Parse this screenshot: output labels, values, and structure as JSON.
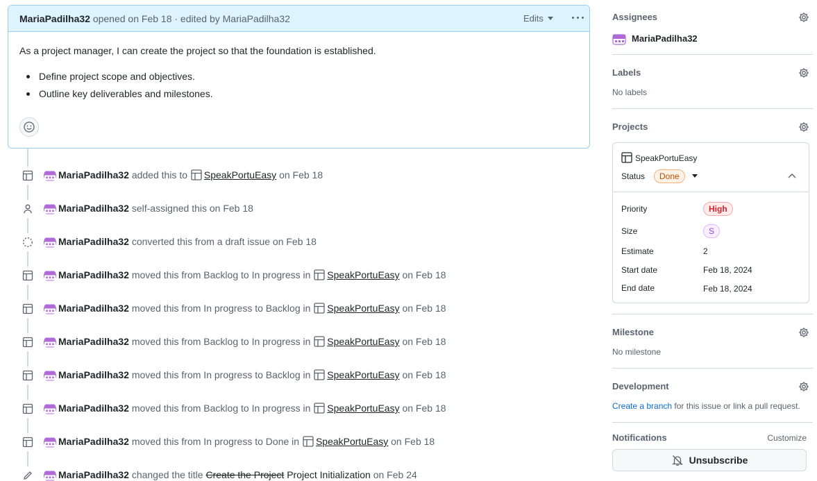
{
  "comment": {
    "author": "MariaPadilha32",
    "opened_text": "opened on Feb 18 · edited by MariaPadilha32",
    "edits_label": "Edits",
    "body_text": "As a project manager, I can create the project so that the foundation is established.",
    "bullets": [
      "Define project scope and objectives.",
      "Outline key deliverables and milestones."
    ]
  },
  "timeline": [
    {
      "icon": "table-icon",
      "actor": "MariaPadilha32",
      "pre": "added this to",
      "project": "SpeakPortuEasy",
      "post": "on Feb 18"
    },
    {
      "icon": "person-icon",
      "actor": "MariaPadilha32",
      "pre": "self-assigned this on Feb 18"
    },
    {
      "icon": "draft-issue-icon",
      "actor": "MariaPadilha32",
      "pre": "converted this from a draft issue on Feb 18"
    },
    {
      "icon": "table-icon",
      "actor": "MariaPadilha32",
      "pre": "moved this from Backlog to In progress in",
      "project": "SpeakPortuEasy",
      "post": "on Feb 18"
    },
    {
      "icon": "table-icon",
      "actor": "MariaPadilha32",
      "pre": "moved this from In progress to Backlog in",
      "project": "SpeakPortuEasy",
      "post": "on Feb 18"
    },
    {
      "icon": "table-icon",
      "actor": "MariaPadilha32",
      "pre": "moved this from Backlog to In progress in",
      "project": "SpeakPortuEasy",
      "post": "on Feb 18"
    },
    {
      "icon": "table-icon",
      "actor": "MariaPadilha32",
      "pre": "moved this from In progress to Backlog in",
      "project": "SpeakPortuEasy",
      "post": "on Feb 18"
    },
    {
      "icon": "table-icon",
      "actor": "MariaPadilha32",
      "pre": "moved this from Backlog to In progress in",
      "project": "SpeakPortuEasy",
      "post": "on Feb 18"
    },
    {
      "icon": "table-icon",
      "actor": "MariaPadilha32",
      "pre": "moved this from In progress to Done in",
      "project": "SpeakPortuEasy",
      "post": "on Feb 18"
    },
    {
      "icon": "pencil-icon",
      "actor": "MariaPadilha32",
      "pre": "changed the title",
      "old_title": "Create the Project",
      "new_title": "Project Initialization",
      "post": "on Feb 24"
    }
  ],
  "sidebar": {
    "assignees": {
      "heading": "Assignees",
      "user": "MariaPadilha32"
    },
    "labels": {
      "heading": "Labels",
      "value": "No labels"
    },
    "projects": {
      "heading": "Projects",
      "name": "SpeakPortuEasy",
      "status_label": "Status",
      "status_value": "Done",
      "fields": [
        {
          "label": "Priority",
          "value": "High"
        },
        {
          "label": "Size",
          "value": "S"
        },
        {
          "label": "Estimate",
          "value": "2"
        },
        {
          "label": "Start date",
          "value": "Feb 18, 2024"
        },
        {
          "label": "End date",
          "value": "Feb 18, 2024"
        }
      ]
    },
    "milestone": {
      "heading": "Milestone",
      "value": "No milestone"
    },
    "development": {
      "heading": "Development",
      "link": "Create a branch",
      "rest": "for this issue or link a pull request."
    },
    "notifications": {
      "heading": "Notifications",
      "customize": "Customize",
      "unsubscribe": "Unsubscribe"
    }
  },
  "colors": {
    "accent_link": "#0969da",
    "header_bg": "#ddf4ff",
    "done_pill": "#bc4c00",
    "high_pill": "#d1242f",
    "size_pill": "#8250df",
    "avatar": "#b06ad8"
  }
}
